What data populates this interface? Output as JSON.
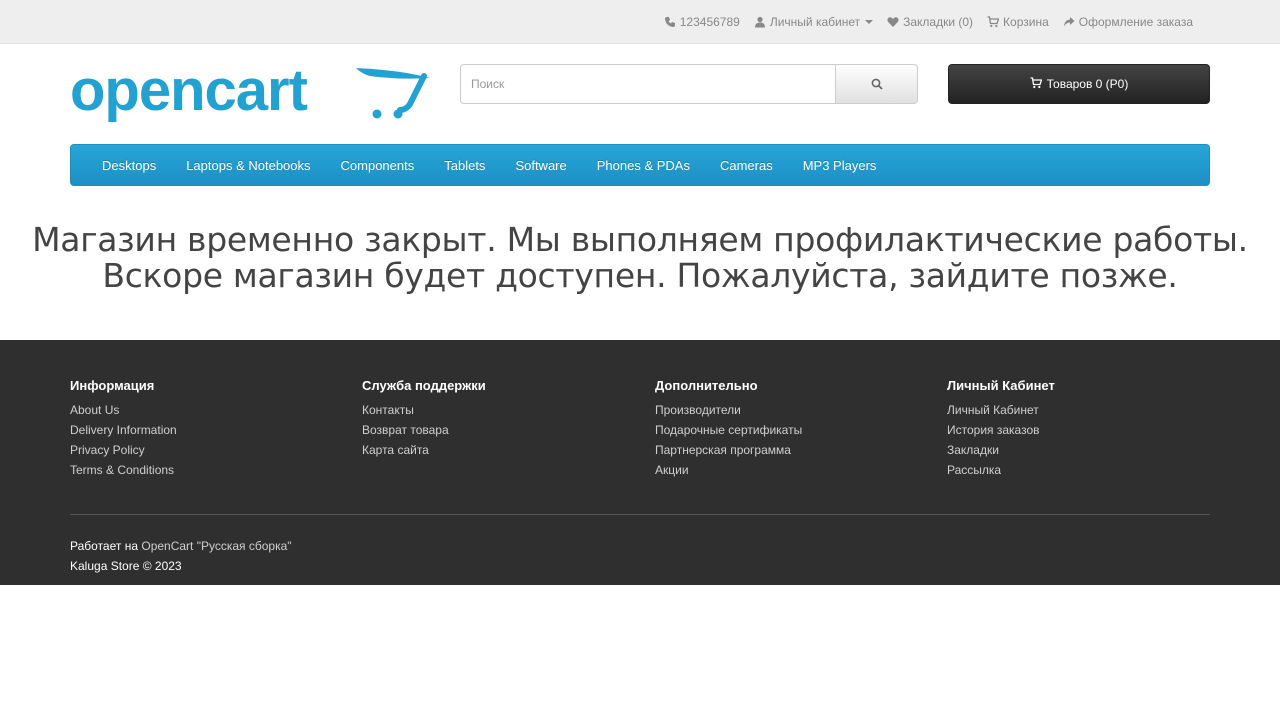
{
  "topbar": {
    "phone": "123456789",
    "account": "Личный кабинет",
    "wishlist": "Закладки (0)",
    "cart": "Корзина",
    "checkout": "Оформление заказа"
  },
  "header": {
    "logo_text": "opencart",
    "search_placeholder": "Поиск",
    "cart_button": "Товаров 0 (Р0)"
  },
  "menu": {
    "items": [
      {
        "label": "Desktops"
      },
      {
        "label": "Laptops & Notebooks"
      },
      {
        "label": "Components"
      },
      {
        "label": "Tablets"
      },
      {
        "label": "Software"
      },
      {
        "label": "Phones & PDAs"
      },
      {
        "label": "Cameras"
      },
      {
        "label": "MP3 Players"
      }
    ]
  },
  "maintenance": {
    "line1": "Магазин временно закрыт. Мы выполняем профилактические работы.",
    "line2": "Вскоре магазин будет доступен. Пожалуйста, зайдите позже."
  },
  "footer": {
    "columns": [
      {
        "title": "Информация",
        "links": [
          "About Us",
          "Delivery Information",
          "Privacy Policy",
          "Terms & Conditions"
        ]
      },
      {
        "title": "Служба поддержки",
        "links": [
          "Контакты",
          "Возврат товара",
          "Карта сайта"
        ]
      },
      {
        "title": "Дополнительно",
        "links": [
          "Производители",
          "Подарочные сертификаты",
          "Партнерская программа",
          "Акции"
        ]
      },
      {
        "title": "Личный Кабинет",
        "links": [
          "Личный Кабинет",
          "История заказов",
          "Закладки",
          "Рассылка"
        ]
      }
    ],
    "powered_prefix": "Работает на",
    "powered_link": "OpenCart \"Русская сборка\"",
    "copyright": "Kaluga Store © 2023"
  },
  "colors": {
    "menu_bg": "#229ac8",
    "footer_bg": "#2f2f2f",
    "logo": "#23a1d1"
  },
  "icons": {
    "phone": "phone-icon",
    "account": "user-icon",
    "wishlist": "heart-icon",
    "cart": "shopping-cart-icon",
    "checkout": "share-icon",
    "search": "search-icon"
  }
}
